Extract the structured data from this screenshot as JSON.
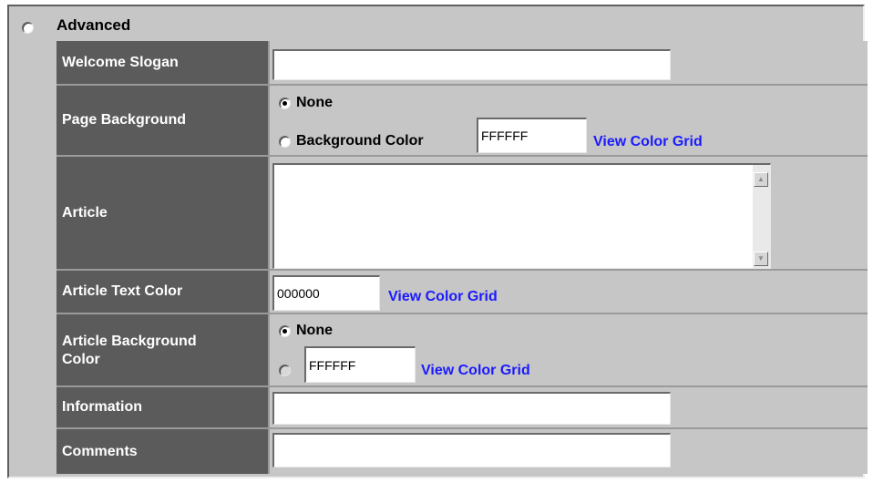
{
  "section": {
    "title": "Advanced"
  },
  "rows": {
    "welcome_slogan": {
      "label": "Welcome Slogan",
      "value": ""
    },
    "page_background": {
      "label": "Page Background",
      "option_none": "None",
      "option_color": "Background Color",
      "color_value": "FFFFFF",
      "link": "View Color Grid"
    },
    "article": {
      "label": "Article",
      "value": ""
    },
    "article_text_color": {
      "label": "Article Text Color",
      "value": "000000",
      "link": "View Color Grid"
    },
    "article_background_color": {
      "label_line1": "Article Background",
      "label_line2": "Color",
      "option_none": "None",
      "color_value": "FFFFFF",
      "link": "View Color Grid"
    },
    "information": {
      "label": "Information",
      "value": ""
    },
    "comments": {
      "label": "Comments",
      "value": ""
    }
  },
  "icons": {
    "scroll_up": "▲",
    "scroll_down": "▼"
  }
}
